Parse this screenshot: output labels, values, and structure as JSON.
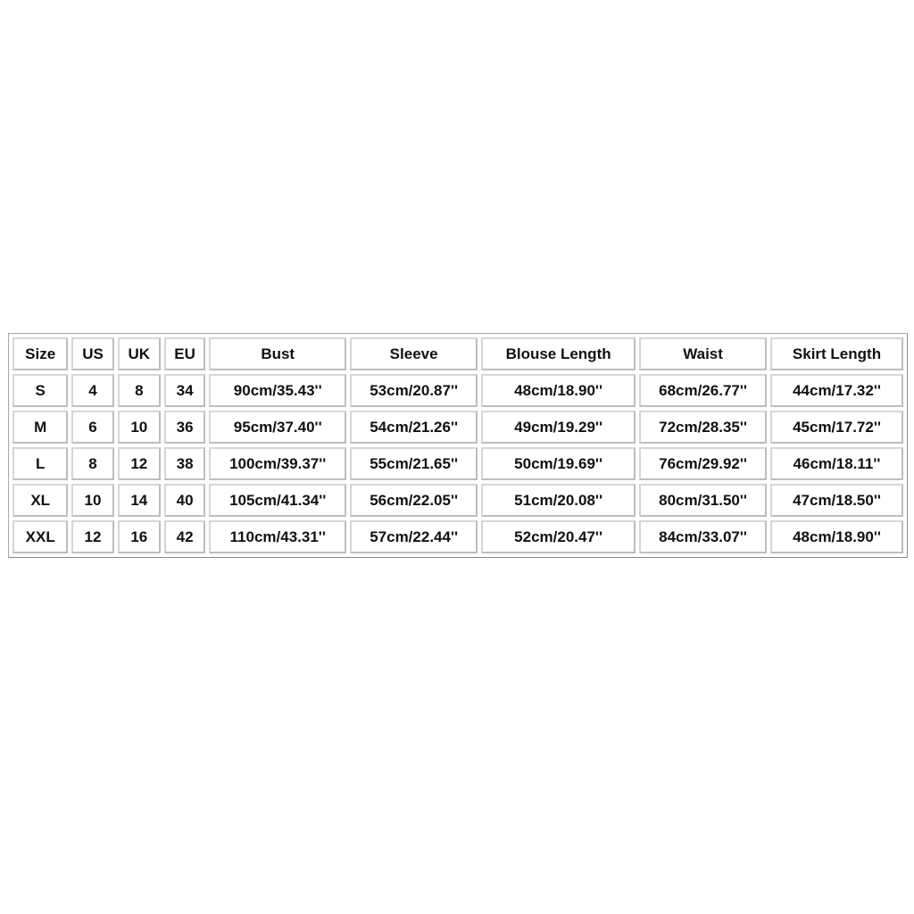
{
  "size_chart": {
    "headers": [
      "Size",
      "US",
      "UK",
      "EU",
      "Bust",
      "Sleeve",
      "Blouse Length",
      "Waist",
      "Skirt Length"
    ],
    "rows": [
      [
        "S",
        "4",
        "8",
        "34",
        "90cm/35.43''",
        "53cm/20.87''",
        "48cm/18.90''",
        "68cm/26.77''",
        "44cm/17.32''"
      ],
      [
        "M",
        "6",
        "10",
        "36",
        "95cm/37.40''",
        "54cm/21.26''",
        "49cm/19.29''",
        "72cm/28.35''",
        "45cm/17.72''"
      ],
      [
        "L",
        "8",
        "12",
        "38",
        "100cm/39.37''",
        "55cm/21.65''",
        "50cm/19.69''",
        "76cm/29.92''",
        "46cm/18.11''"
      ],
      [
        "XL",
        "10",
        "14",
        "40",
        "105cm/41.34''",
        "56cm/22.05''",
        "51cm/20.08''",
        "80cm/31.50''",
        "47cm/18.50''"
      ],
      [
        "XXL",
        "12",
        "16",
        "42",
        "110cm/43.31''",
        "57cm/22.44''",
        "52cm/20.47''",
        "84cm/33.07''",
        "48cm/18.90''"
      ]
    ]
  }
}
